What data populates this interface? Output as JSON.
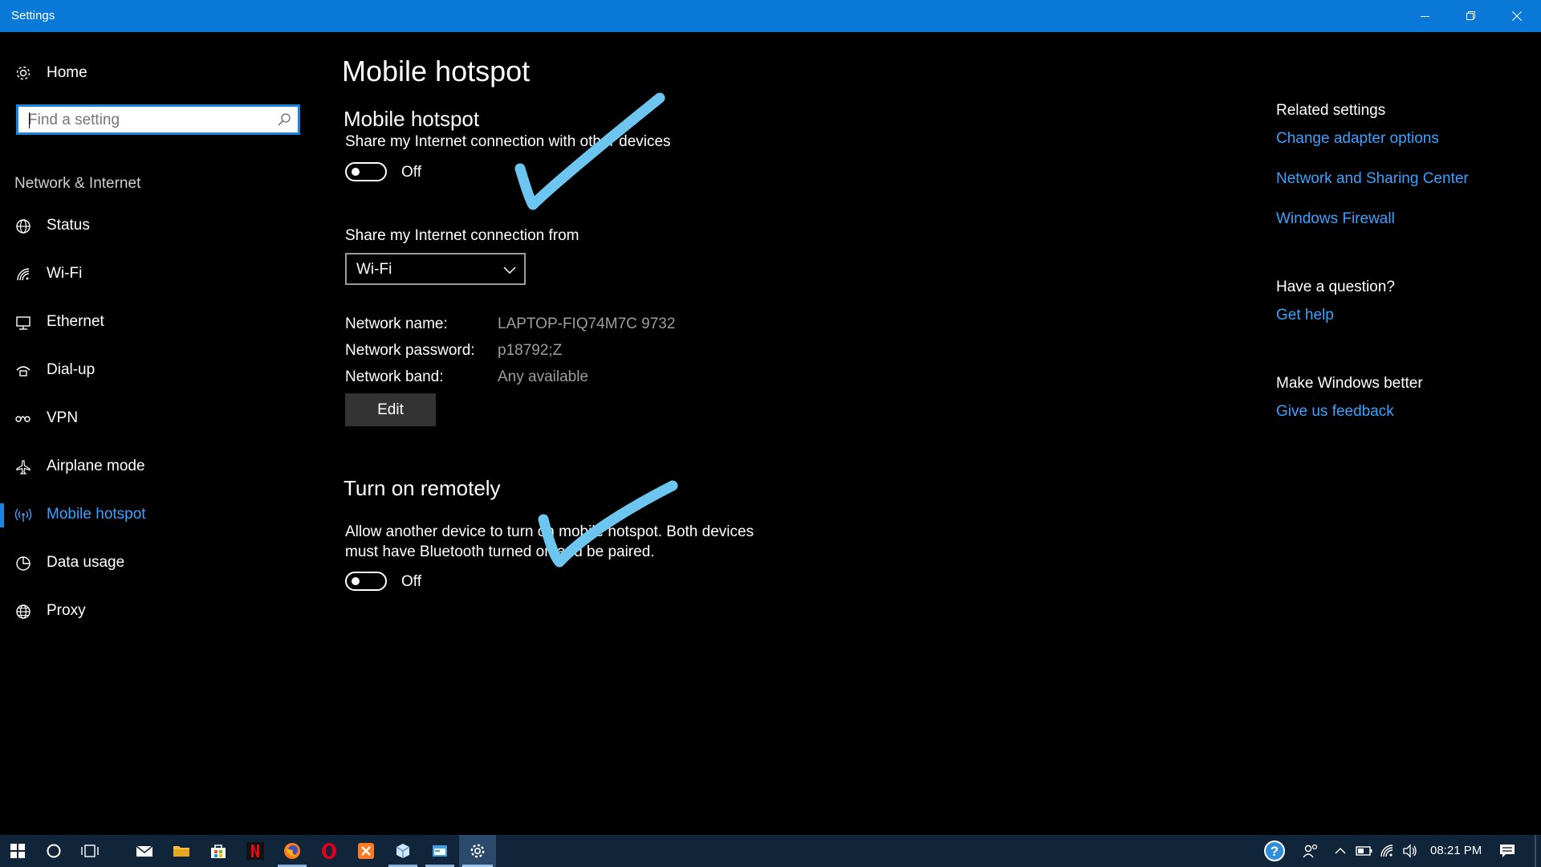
{
  "window": {
    "title": "Settings"
  },
  "sidebar": {
    "home_label": "Home",
    "search_placeholder": "Find a setting",
    "section_label": "Network & Internet",
    "items": [
      {
        "label": "Status",
        "icon": "globe-status-icon"
      },
      {
        "label": "Wi-Fi",
        "icon": "wifi-icon"
      },
      {
        "label": "Ethernet",
        "icon": "ethernet-icon"
      },
      {
        "label": "Dial-up",
        "icon": "dialup-icon"
      },
      {
        "label": "VPN",
        "icon": "vpn-icon"
      },
      {
        "label": "Airplane mode",
        "icon": "airplane-icon"
      },
      {
        "label": "Mobile hotspot",
        "icon": "hotspot-icon",
        "active": true
      },
      {
        "label": "Data usage",
        "icon": "data-usage-icon"
      },
      {
        "label": "Proxy",
        "icon": "globe-icon"
      }
    ]
  },
  "main": {
    "page_title": "Mobile hotspot",
    "hotspot": {
      "heading": "Mobile hotspot",
      "description": "Share my Internet connection with other devices",
      "toggle_state": "Off"
    },
    "share_from": {
      "label": "Share my Internet connection from",
      "selected": "Wi-Fi"
    },
    "network_info": {
      "name_label": "Network name:",
      "name_value": "LAPTOP-FIQ74M7C 9732",
      "password_label": "Network password:",
      "password_value": "p18792;Z",
      "band_label": "Network band:",
      "band_value": "Any available"
    },
    "edit_label": "Edit",
    "remote": {
      "heading": "Turn on remotely",
      "description": "Allow another device to turn on mobile hotspot. Both devices must have Bluetooth turned on and be paired.",
      "toggle_state": "Off"
    }
  },
  "related": {
    "heading": "Related settings",
    "links": [
      "Change adapter options",
      "Network and Sharing Center",
      "Windows Firewall"
    ],
    "question_heading": "Have a question?",
    "help_link": "Get help",
    "better_heading": "Make Windows better",
    "feedback_link": "Give us feedback"
  },
  "annotations": {
    "checkmark_color": "#6cc6f0"
  },
  "taskbar": {
    "apps": [
      "mail",
      "file-explorer",
      "store",
      "netflix",
      "firefox",
      "opera",
      "xampp",
      "app-cube",
      "app-window",
      "settings"
    ],
    "clock": "08:21 PM"
  },
  "colors": {
    "titlebar": "#0a78d7",
    "accent": "#3aa2ff",
    "background": "#000000",
    "taskbar": "#10243a"
  }
}
